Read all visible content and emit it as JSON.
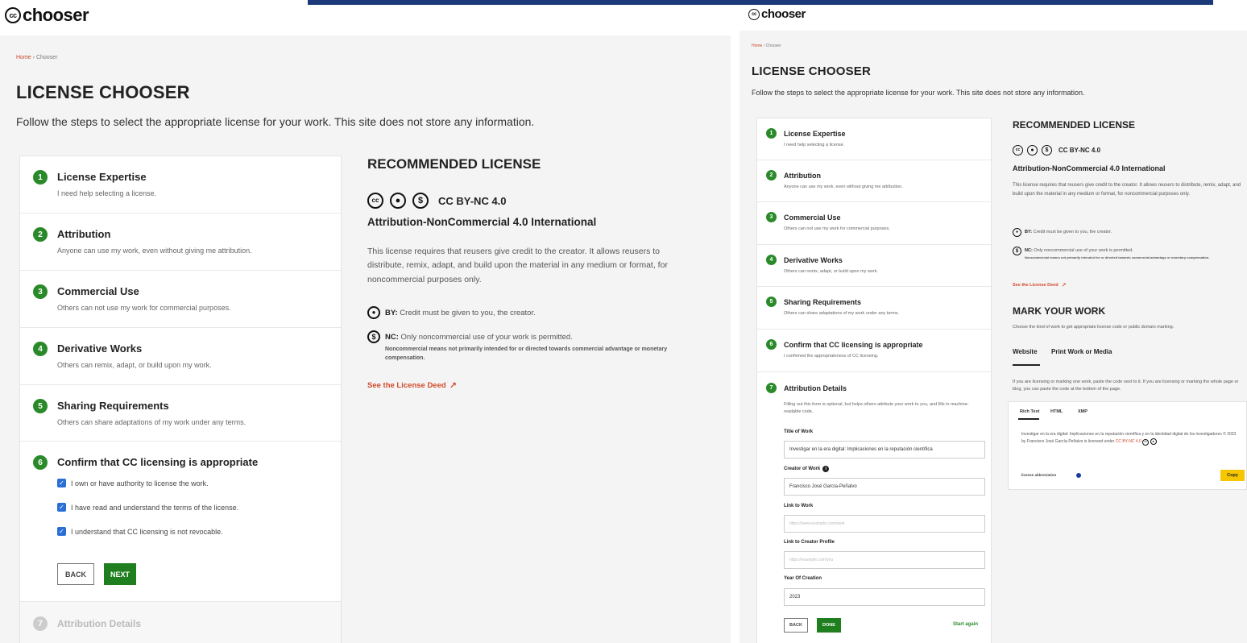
{
  "app": {
    "logo_text": "chooser",
    "cc_mark": "cc"
  },
  "breadcrumb": {
    "home": "Home",
    "sep": "›",
    "current": "Chooser"
  },
  "page": {
    "title": "LICENSE CHOOSER",
    "subtitle": "Follow the steps to select the appropriate license for your work. This site does not store any information."
  },
  "steps": [
    {
      "num": "1",
      "label": "License Expertise",
      "desc": "I need help selecting a license."
    },
    {
      "num": "2",
      "label": "Attribution",
      "desc": "Anyone can use my work, even without giving me attribution."
    },
    {
      "num": "3",
      "label": "Commercial Use",
      "desc": "Others can not use my work for commercial purposes."
    },
    {
      "num": "4",
      "label": "Derivative Works",
      "desc": "Others can remix, adapt, or build upon my work."
    },
    {
      "num": "5",
      "label": "Sharing Requirements",
      "desc": "Others can share adaptations of my work under any terms."
    },
    {
      "num": "6",
      "label": "Confirm that CC licensing is appropriate",
      "desc": "I confirmed the appropriateness of CC licensing."
    },
    {
      "num": "7",
      "label": "Attribution Details",
      "desc": "Filling out this form is optional, but helps others attribute your work to you, and fills in machine-readable code."
    }
  ],
  "confirm": {
    "checks": [
      "I own or have authority to license the work.",
      "I have read and understand the terms of the license.",
      "I understand that CC licensing is not revocable."
    ],
    "back": "BACK",
    "next": "NEXT"
  },
  "license": {
    "heading": "RECOMMENDED LICENSE",
    "short": "CC BY-NC 4.0",
    "name": "Attribution-NonCommercial 4.0 International",
    "body": "This license requires that reusers give credit to the creator. It allows reusers to distribute, remix, adapt, and build upon the material in any medium or format, for noncommercial purposes only.",
    "by_label": "BY:",
    "by_text": "Credit must be given to you, the creator.",
    "nc_label": "NC:",
    "nc_text": "Only noncommercial use of your work is permitted.",
    "nc_note": "Noncommercial means not primarily intended for or directed towards commercial advantage or monetary compensation.",
    "deed": "See the License Deed"
  },
  "attribution_form": {
    "title_label": "Title of Work",
    "title_value": "Investigar en la era digital: Implicaciones en la reputación científica",
    "creator_label": "Creator of Work",
    "creator_value": "Francisco José García-Peñalvo",
    "link_label": "Link to Work",
    "link_placeholder": "https://www.example.com/work",
    "profile_label": "Link to Creator Profile",
    "profile_placeholder": "https://example.com/you",
    "year_label": "Year Of Creation",
    "year_value": "2023",
    "back": "BACK",
    "done": "DONE",
    "start_again": "Start again"
  },
  "mark": {
    "heading": "MARK YOUR WORK",
    "desc": "Choose the kind of work to get appropriate license code or public domain marking.",
    "tabs": [
      "Website",
      "Print Work or Media"
    ],
    "intro": "If you are licensing or marking one work, paste the code next to it. If you are licensing or marking the whole page or blog, you can paste the code at the bottom of the page.",
    "subtabs": [
      "Rich Text",
      "HTML",
      "XMP"
    ],
    "code_text": "Investigar en la era digital: Implicaciones en la reputación científica y en la identidad digital de los investigadores © 2023 by Francisco José García-Peñalvo is licensed under",
    "code_link": "CC BY-NC 4.0",
    "toggle_label": "license abbreviation",
    "copy": "Copy"
  },
  "colors": {
    "green": "#1f7f1f",
    "orange": "#d2492a",
    "accent_blue": "#1c3a7a",
    "copy_yellow": "#f6c700"
  }
}
